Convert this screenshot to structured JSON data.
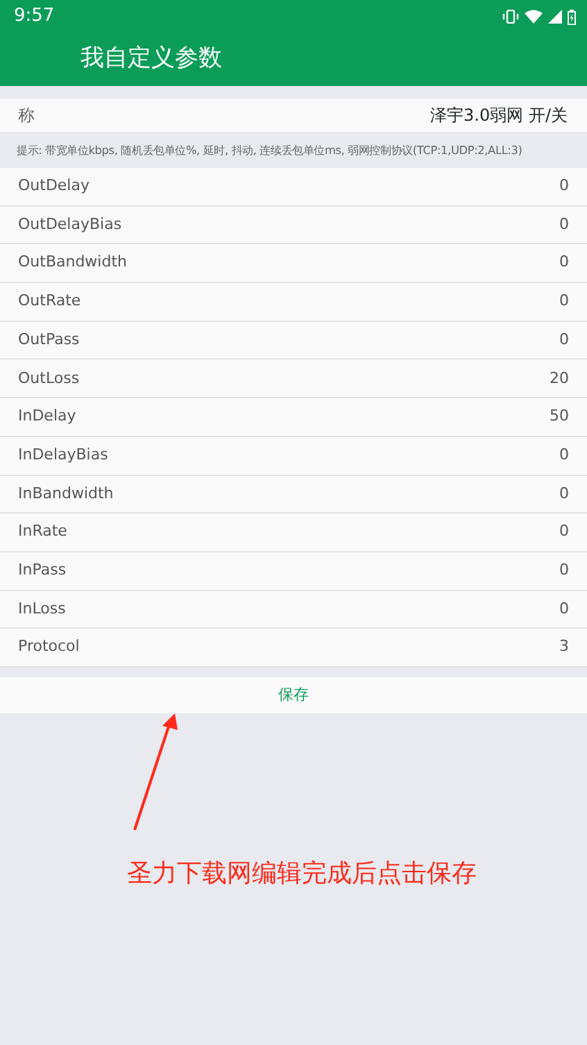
{
  "status_bar": {
    "time": "9:57"
  },
  "toolbar": {
    "title": "我自定义参数"
  },
  "name_row": {
    "label": "称",
    "value": "泽宇3.0弱网 开/关"
  },
  "hint": "提示: 带宽单位kbps, 随机丢包单位%, 延时, 抖动, 连续丢包单位ms, 弱网控制协议(TCP:1,UDP:2,ALL:3)",
  "params": [
    {
      "name": "OutDelay",
      "value": "0"
    },
    {
      "name": "OutDelayBias",
      "value": "0"
    },
    {
      "name": "OutBandwidth",
      "value": "0"
    },
    {
      "name": "OutRate",
      "value": "0"
    },
    {
      "name": "OutPass",
      "value": "0"
    },
    {
      "name": "OutLoss",
      "value": "20"
    },
    {
      "name": "InDelay",
      "value": "50"
    },
    {
      "name": "InDelayBias",
      "value": "0"
    },
    {
      "name": "InBandwidth",
      "value": "0"
    },
    {
      "name": "InRate",
      "value": "0"
    },
    {
      "name": "InPass",
      "value": "0"
    },
    {
      "name": "InLoss",
      "value": "0"
    },
    {
      "name": "Protocol",
      "value": "3"
    }
  ],
  "save_button": "保存",
  "annotation": "圣力下载网编辑完成后点击保存"
}
